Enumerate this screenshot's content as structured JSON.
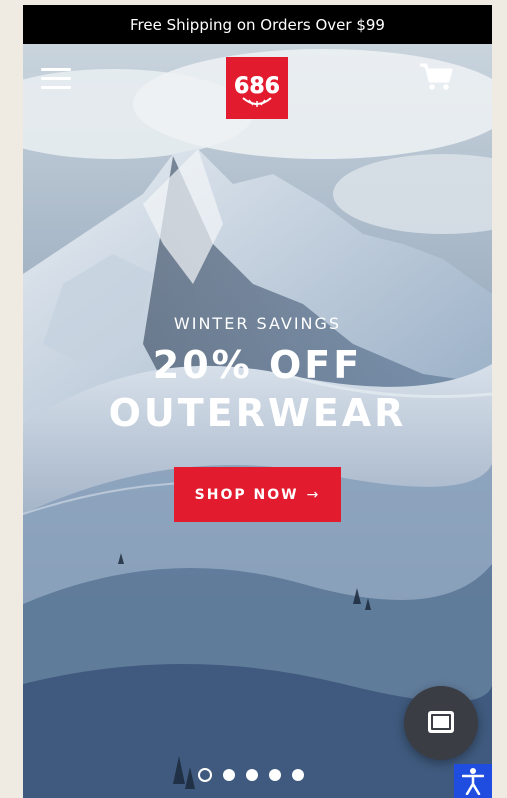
{
  "announcement": {
    "text": "Free Shipping on Orders Over $99"
  },
  "header": {
    "menu_icon": "hamburger-menu-icon",
    "logo_text": "686",
    "cart_icon": "shopping-cart-icon"
  },
  "hero": {
    "eyebrow": "WINTER SAVINGS",
    "headline_line1": "20% OFF",
    "headline_line2": "OUTERWEAR",
    "cta_label": "SHOP NOW",
    "cta_arrow": "→"
  },
  "slider": {
    "count": 5,
    "active_index": 0
  },
  "chat": {
    "icon": "chat-bubble-icon"
  },
  "accessibility": {
    "icon": "accessibility-icon"
  },
  "colors": {
    "brand_red": "#e31b2f",
    "announce_bg": "#000000",
    "a11y_blue": "#1e4de0",
    "chat_bg": "#3a3d44"
  }
}
